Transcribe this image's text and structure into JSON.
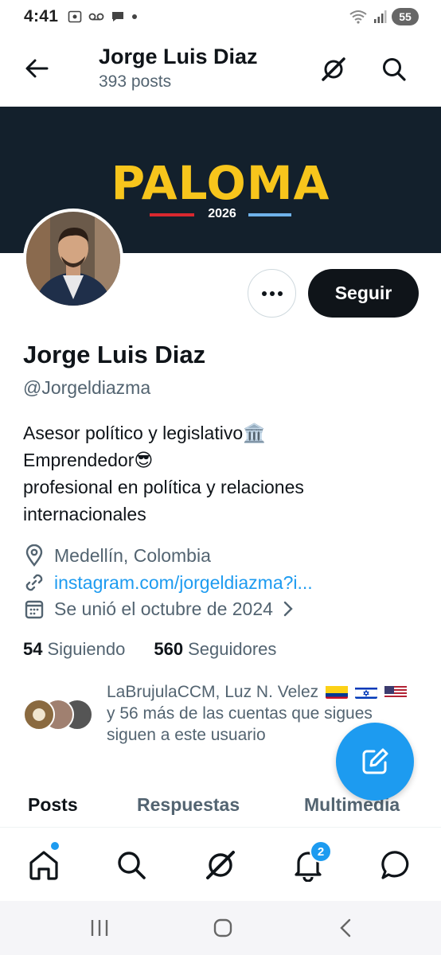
{
  "status_bar": {
    "time": "4:41",
    "battery": "55"
  },
  "header": {
    "name": "Jorge Luis Diaz",
    "posts": "393 posts"
  },
  "banner": {
    "title": "PALOMA",
    "year": "2026"
  },
  "actions": {
    "follow_label": "Seguir"
  },
  "profile": {
    "name": "Jorge Luis Diaz",
    "handle": "@Jorgeldiazma",
    "bio_lines": [
      "Asesor político y legislativo🏛️",
      "Emprendedor😎",
      "profesional en política y relaciones",
      "internacionales"
    ],
    "location": "Medellín, Colombia",
    "website": "instagram.com/jorgeldiazma?i...",
    "joined": "Se unió el octubre de 2024"
  },
  "stats": {
    "following_count": "54",
    "following_label": "Siguiendo",
    "followers_count": "560",
    "followers_label": "Seguidores"
  },
  "followed_by": {
    "line1": "LaBrujulaCCM, Luz N. Velez",
    "line2": "y 56 más de las cuentas que sigues",
    "line3": "siguen a este usuario"
  },
  "tabs": [
    "Posts",
    "Respuestas",
    "Multimedia"
  ],
  "notifications_badge": "2",
  "colors": {
    "accent": "#1d9bf0",
    "banner_bg": "#13202c",
    "banner_title": "#f7c51c"
  }
}
